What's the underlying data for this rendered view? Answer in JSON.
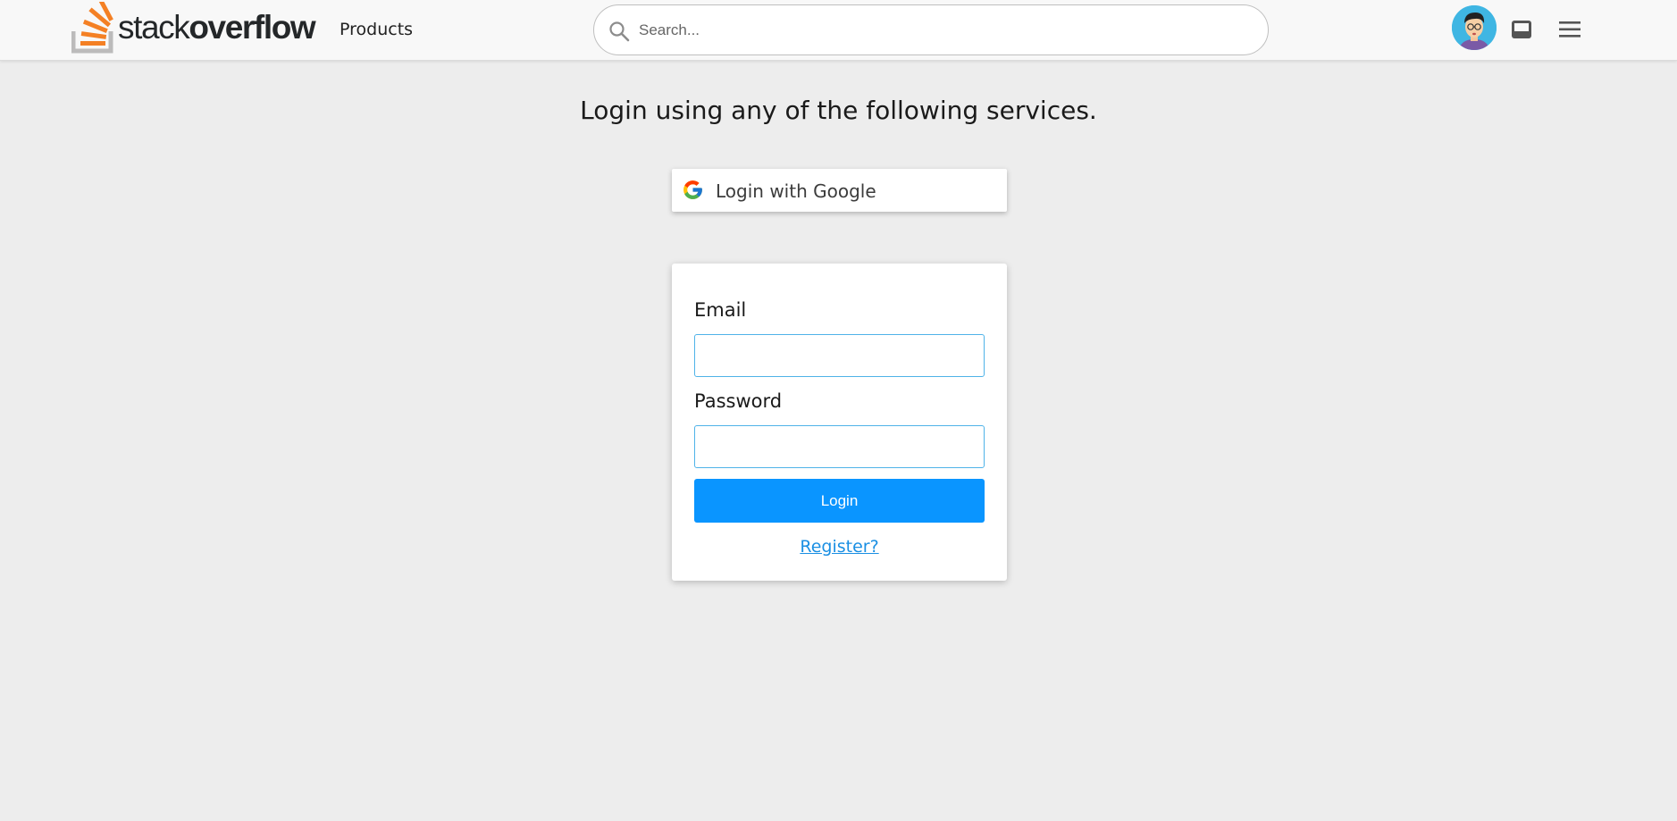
{
  "header": {
    "logo": {
      "word_light": "stack",
      "word_bold": "overflow"
    },
    "products_label": "Products",
    "search": {
      "placeholder": "Search...",
      "value": ""
    },
    "icons": [
      "search-icon",
      "avatar",
      "inbox-icon",
      "hamburger-menu-icon"
    ]
  },
  "main": {
    "heading": "Login using any of the following services.",
    "google_button_label": "Login with Google",
    "form": {
      "email_label": "Email",
      "email_value": "",
      "password_label": "Password",
      "password_value": "",
      "login_button_label": "Login",
      "register_link": "Register?"
    }
  },
  "colors": {
    "page_background": "#ededed",
    "header_background": "#f8f8f8",
    "logo_orange": "#f48024",
    "logo_gray": "#bcbbbb",
    "primary_button": "#0a95ff",
    "input_border": "#4fb3e8",
    "link": "#1a8fe3",
    "avatar_background": "#3fb6e3"
  }
}
